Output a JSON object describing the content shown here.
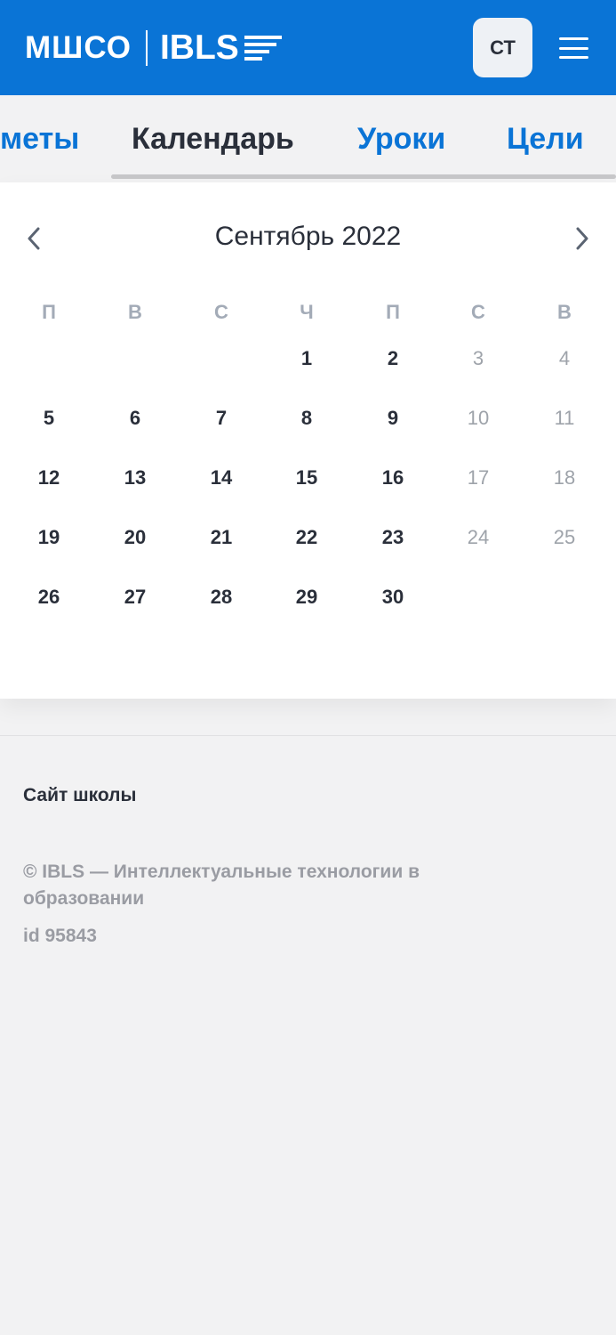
{
  "header": {
    "logo_left": "МШСО",
    "logo_right": "IBLS",
    "avatar_initials": "СТ",
    "menu_icon": "hamburger-menu-icon",
    "brand_color": "#0a74d6"
  },
  "tabs": [
    {
      "label": "меты",
      "active": false
    },
    {
      "label": "Календарь",
      "active": true
    },
    {
      "label": "Уроки",
      "active": false
    },
    {
      "label": "Цели",
      "active": false
    }
  ],
  "calendar": {
    "month_title": "Сентябрь 2022",
    "prev_icon": "chevron-left-icon",
    "next_icon": "chevron-right-icon",
    "weekdays": [
      "П",
      "В",
      "С",
      "Ч",
      "П",
      "С",
      "В"
    ],
    "weeks": [
      [
        "",
        "",
        "",
        "1",
        "2",
        "3",
        "4"
      ],
      [
        "5",
        "6",
        "7",
        "8",
        "9",
        "10",
        "11"
      ],
      [
        "12",
        "13",
        "14",
        "15",
        "16",
        "17",
        "18"
      ],
      [
        "19",
        "20",
        "21",
        "22",
        "23",
        "24",
        "25"
      ],
      [
        "26",
        "27",
        "28",
        "29",
        "30",
        "",
        ""
      ]
    ]
  },
  "footer": {
    "site_link": "Сайт школы",
    "copyright": "© IBLS — Интеллектуальные технологии в образовании",
    "id_text": "id 95843"
  }
}
